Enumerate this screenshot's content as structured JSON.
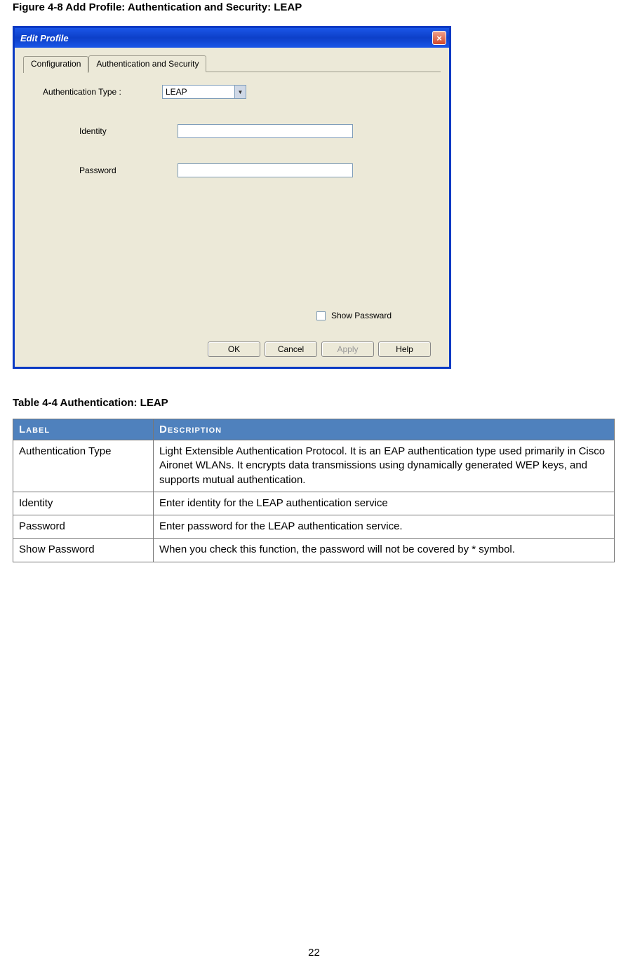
{
  "figure_title": "Figure 4-8 Add Profile: Authentication and Security: LEAP",
  "dialog": {
    "title": "Edit Profile",
    "close_label": "×",
    "tabs": [
      {
        "label": "Configuration",
        "active": false
      },
      {
        "label": "Authentication and Security",
        "active": true
      }
    ],
    "auth_type_label": "Authentication Type :",
    "auth_type_value": "LEAP",
    "identity_label": "Identity",
    "identity_value": "",
    "password_label": "Password",
    "password_value": "",
    "show_password_label": "Show Passward",
    "buttons": {
      "ok": "OK",
      "cancel": "Cancel",
      "apply": "Apply",
      "help": "Help"
    }
  },
  "table_title": "Table 4-4 Authentication: LEAP",
  "table": {
    "header_label": "Label",
    "header_description": "Description",
    "rows": [
      {
        "label": "Authentication Type",
        "desc": "Light Extensible Authentication Protocol. It is an EAP authentication type used primarily in Cisco Aironet WLANs. It encrypts data transmissions using dynamically generated WEP keys, and supports mutual authentication."
      },
      {
        "label": "Identity",
        "desc": "Enter identity for the LEAP authentication service"
      },
      {
        "label": "Password",
        "desc": "Enter password for the LEAP authentication service."
      },
      {
        "label": "Show Password",
        "desc": "When you check this function, the password will not be covered by * symbol."
      }
    ]
  },
  "page_number": "22"
}
